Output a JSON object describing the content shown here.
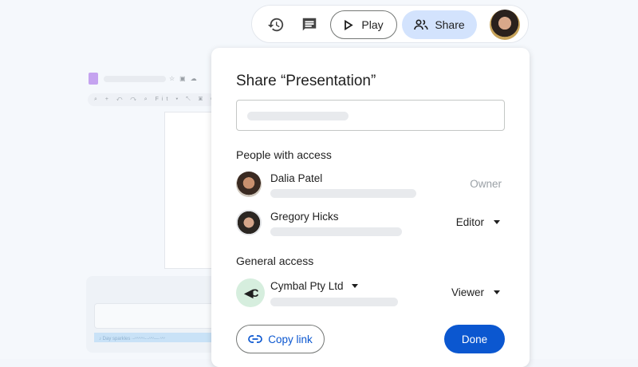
{
  "background": {
    "audio_caption": "Day sparkles"
  },
  "topbar": {
    "play_label": "Play",
    "share_label": "Share"
  },
  "dialog": {
    "title": "Share “Presentation”",
    "people_heading": "People with access",
    "people": [
      {
        "name": "Dalia Patel",
        "role": "Owner"
      },
      {
        "name": "Gregory Hicks",
        "role": "Editor"
      }
    ],
    "general_heading": "General access",
    "general": {
      "org": "Cymbal Pty Ltd",
      "role": "Viewer"
    },
    "copy_link_label": "Copy link",
    "done_label": "Done"
  },
  "colors": {
    "accent": "#0b57d0",
    "share_bg": "#d3e3fd"
  }
}
